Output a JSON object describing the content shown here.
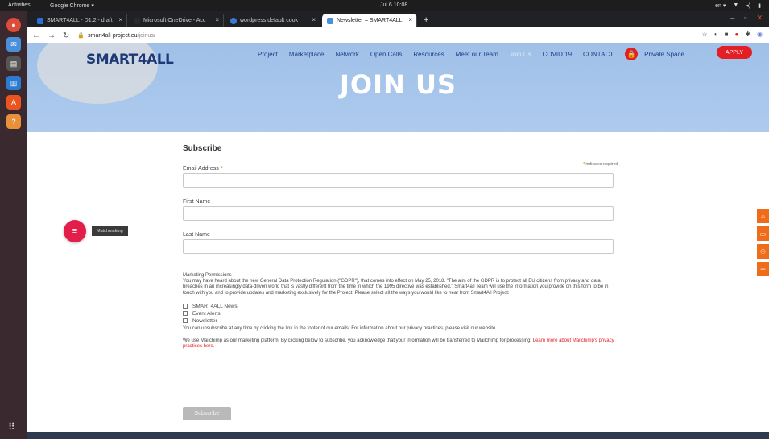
{
  "os": {
    "activities": "Activities",
    "app": "Google Chrome ▾",
    "clock": "Jul 6  10:08",
    "tray": [
      "en ▾",
      "▼",
      "◂)",
      "▮"
    ]
  },
  "browser": {
    "tabs": [
      {
        "label": "SMART4ALL - D1.2 - draft",
        "favicon_color": "#2a6fd6"
      },
      {
        "label": "Microsoft OneDrive - Acc",
        "favicon_color": "#2a2a2a"
      },
      {
        "label": "wordpress default cook",
        "favicon_color": "#3a7bd5"
      },
      {
        "label": "Newsletter – SMART4ALL",
        "favicon_color": "#4a90d9"
      }
    ],
    "new_tab": "+",
    "url_host": "smart4all-project.eu",
    "url_path": "/joinus/",
    "window_controls": [
      "–",
      "▫",
      "✕"
    ]
  },
  "site": {
    "logo": "SMART4ALL",
    "nav": [
      "Project",
      "Marketplace",
      "Network",
      "Open Calls",
      "Resources",
      "Meet our Team",
      "Join Us",
      "COVID 19",
      "CONTACT"
    ],
    "private_space": "Private Space",
    "apply": "APPLY",
    "hero_title": "JOIN US"
  },
  "form": {
    "title": "Subscribe",
    "required_note": "indicates required",
    "email_label": "Email Address",
    "first_name_label": "First Name",
    "last_name_label": "Last Name",
    "permissions_title": "Marketing Permissions",
    "permissions_text": "You may have heard about the new General Data Protection Regulation (\"GDPR\"), that comes into effect on May 25, 2018. \"The aim of the GDPR is to protect all EU citizens from privacy and data breaches in an increasingly data-driven world that is vastly different from the time in which the 1995 directive was established.\" Smart4all Team will use the information you provide on this form to be in touch with you and to provide updates and marketing exclusively for the Project. Please select all the ways you would like to hear from Smart4All Project:",
    "options": [
      "SMART4ALL News",
      "Event Alerts",
      "Newsletter"
    ],
    "unsubscribe_text": "You can unsubscribe at any time by clicking the link in the footer of our emails. For information about our privacy practices, please visit our website.",
    "mailchimp_text": "We use Mailchimp as our marketing platform. By clicking below to subscribe, you acknowledge that your information will be transferred to Mailchimp for processing.",
    "mailchimp_link": "Learn more about Mailchimp's privacy practices here.",
    "submit": "Subscribe"
  },
  "matchmaking": "Matchmaking"
}
